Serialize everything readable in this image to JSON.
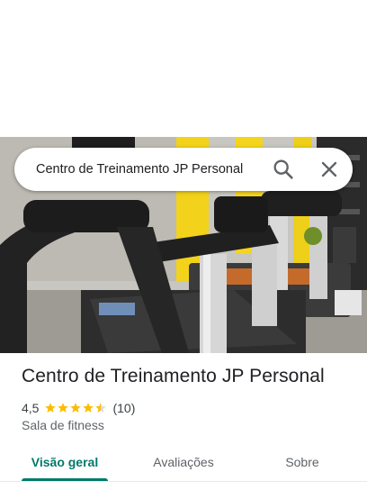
{
  "search": {
    "query": "Centro de Treinamento JP Personal",
    "search_icon": "search-icon",
    "close_icon": "close-icon"
  },
  "place": {
    "name": "Centro de Treinamento JP Personal",
    "rating": "4,5",
    "rating_stars": 4.5,
    "review_count": "(10)",
    "category": "Sala de fitness",
    "photo_icon": "treadmill-photo"
  },
  "tabs": [
    {
      "label": "Visão geral",
      "active": true
    },
    {
      "label": "Avaliações",
      "active": false
    },
    {
      "label": "Sobre",
      "active": false
    }
  ],
  "colors": {
    "accent": "#00796b",
    "star": "#fbbc04",
    "text_primary": "#202124",
    "text_secondary": "#5f6368"
  }
}
